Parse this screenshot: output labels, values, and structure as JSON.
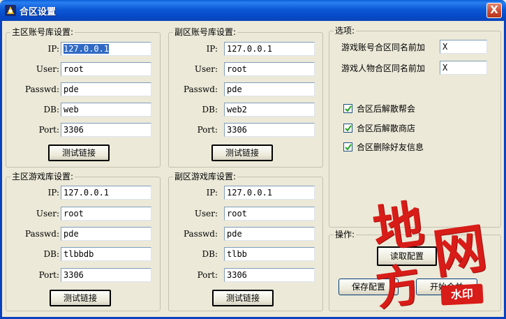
{
  "window": {
    "title": "合区设置",
    "close_glyph": "X"
  },
  "common_labels": {
    "ip": "IP:",
    "user": "User:",
    "passwd": "Passwd:",
    "db": "DB:",
    "port": "Port:",
    "test_button": "测试链接"
  },
  "main_account_db": {
    "title": "主区账号库设置:",
    "ip": "127.0.0.1",
    "user": "root",
    "passwd": "pde",
    "db": "web",
    "port": "3306"
  },
  "sub_account_db": {
    "title": "副区账号库设置:",
    "ip": "127.0.0.1",
    "user": "root",
    "passwd": "pde",
    "db": "web2",
    "port": "3306"
  },
  "main_game_db": {
    "title": "主区游戏库设置:",
    "ip": "127.0.0.1",
    "user": "root",
    "passwd": "pde",
    "db": "tlbbdb",
    "port": "3306"
  },
  "sub_game_db": {
    "title": "副区游戏库设置:",
    "ip": "127.0.0.1",
    "user": "root",
    "passwd": "pde",
    "db": "tlbb",
    "port": "3306"
  },
  "options": {
    "title": "选项:",
    "account_prefix_label": "游戏账号合区同名前加",
    "account_prefix_value": "X",
    "role_prefix_label": "游戏人物合区同名前加",
    "role_prefix_value": "X",
    "checkboxes": [
      {
        "label": "合区后解散帮会",
        "checked": true
      },
      {
        "label": "合区后解散商店",
        "checked": true
      },
      {
        "label": "合区删除好友信息",
        "checked": true
      }
    ]
  },
  "operations": {
    "title": "操作:",
    "read_config": "读取配置",
    "save_config": "保存配置",
    "start_merge": "开始合并"
  },
  "watermark": {
    "chars": [
      "地",
      "网",
      "方"
    ],
    "stamp": "水印"
  },
  "colors": {
    "titlebar": "#0c59d6",
    "dialog_bg": "#ece9d8",
    "selection": "#316ac5",
    "watermark_red": "#d81c18"
  }
}
